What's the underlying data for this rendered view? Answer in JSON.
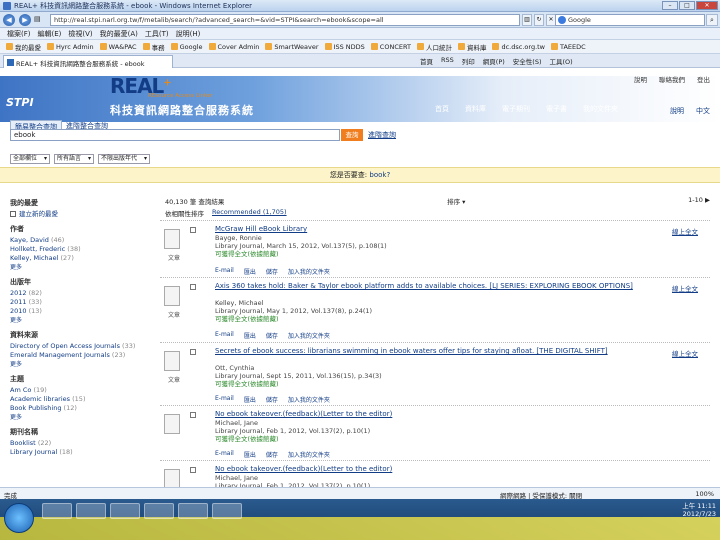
{
  "window": {
    "title": "REAL+ 科技資訊網路整合服務系統 - ebook - Windows Internet Explorer",
    "address": "http://real.stpi.narl.org.tw/f/metalib/search/?advanced_search=&vid=STPI&search=ebook&scope=all",
    "search_engine": "Google",
    "menu": [
      "檔案(F)",
      "編輯(E)",
      "檢視(V)",
      "我的最愛(A)",
      "工具(T)",
      "說明(H)"
    ],
    "favorites": [
      "我的最愛",
      "Hyrc Admin",
      "WA&PAC",
      "事務",
      "Google",
      "Cover Admin",
      "SmartWeaver",
      "ISS NDDS",
      "CONCERT",
      "人口統計",
      "資料庫",
      "dc.dsc.org.tw",
      "TAEEDC"
    ],
    "tab": "REAL+ 科技資訊網路整合服務系統 - ebook",
    "commands": [
      "首頁",
      "RSS",
      "列印",
      "網頁(P)",
      "安全性(S)",
      "工具(O)"
    ]
  },
  "header": {
    "logo_org": "STPI",
    "logo_name": "REAL",
    "logo_plus": "+",
    "logo_sub": "REsource Access Linker",
    "logo_cn": "科技資訊網路整合服務系統",
    "top_links": [
      "說明",
      "聯絡我們",
      "登出"
    ],
    "nav": [
      "首頁",
      "資料庫",
      "電子期刊",
      "電子書",
      "我的文件夾"
    ],
    "nav_right": [
      "說明",
      "中文"
    ]
  },
  "search": {
    "tabs": [
      "簡易整合查詢",
      "進階整合查詢"
    ],
    "query": "ebook",
    "button": "查詢",
    "advanced": "進階查詢",
    "filters": [
      "全部欄位",
      "所有語言",
      "不限出版年代"
    ]
  },
  "suggestion": {
    "prefix": "您是否要查: ",
    "term": "book?"
  },
  "facets": [
    {
      "heading": "我的最愛",
      "items": [
        {
          "label": "建立新的最愛",
          "count": ""
        }
      ],
      "more": ""
    },
    {
      "heading": "作者",
      "items": [
        {
          "label": "Kaye, David",
          "count": "(46)"
        },
        {
          "label": "Hollkett, Frederic",
          "count": "(38)"
        },
        {
          "label": "Kelley, Michael",
          "count": "(27)"
        }
      ],
      "more": "更多"
    },
    {
      "heading": "出版年",
      "items": [
        {
          "label": "2012",
          "count": "(82)"
        },
        {
          "label": "2011",
          "count": "(33)"
        },
        {
          "label": "2010",
          "count": "(13)"
        }
      ],
      "more": "更多"
    },
    {
      "heading": "資料來源",
      "items": [
        {
          "label": "Directory of Open Access Journals",
          "count": "(33)"
        },
        {
          "label": "Emerald Management Journals",
          "count": "(23)"
        }
      ],
      "more": "更多"
    },
    {
      "heading": "主題",
      "items": [
        {
          "label": "Am Co",
          "count": "(19)"
        },
        {
          "label": "Academic libraries",
          "count": "(15)"
        },
        {
          "label": "Book Publishing",
          "count": "(12)"
        }
      ],
      "more": "更多"
    },
    {
      "heading": "期刊名稱",
      "items": [
        {
          "label": "Booklist",
          "count": "(22)"
        },
        {
          "label": "Library Journal",
          "count": "(18)"
        }
      ],
      "more": ""
    }
  ],
  "results_header": {
    "summary": "40,130 筆 查詢結果",
    "sort_label": "依相關性排序",
    "pager": "1-10",
    "sort_by": "排序",
    "relevance_link": "Recommended (1,705)"
  },
  "results": [
    {
      "title": "McGraw Hill eBook Library",
      "meta1": "Bayge, Ronnie",
      "meta2": "Library Journal, March 15, 2012, Vol.137(5), p.108(1)",
      "avail": "可獲得全文(依據館藏)",
      "type": "文章",
      "actions": [
        "E-mail",
        "匯出",
        "儲存",
        "加入我的文件夾"
      ],
      "full": "線上全文"
    },
    {
      "title": "Axis 360 takes hold: Baker & Taylor ebook platform adds to available choices. [LJ SERIES: EXPLORING EBOOK OPTIONS]",
      "meta1": "Kelley, Michael",
      "meta2": "Library Journal, May 1, 2012, Vol.137(8), p.24(1)",
      "avail": "可獲得全文(依據館藏)",
      "type": "文章",
      "actions": [
        "E-mail",
        "匯出",
        "儲存",
        "加入我的文件夾"
      ],
      "full": "線上全文"
    },
    {
      "title": "Secrets of ebook success: librarians swimming in ebook waters offer tips for staying afloat. [THE DIGITAL SHIFT]",
      "meta1": "Ott, Cynthia",
      "meta2": "Library Journal, Sept 15, 2011, Vol.136(15), p.34(3)",
      "avail": "可獲得全文(依據館藏)",
      "type": "文章",
      "actions": [
        "E-mail",
        "匯出",
        "儲存",
        "加入我的文件夾"
      ],
      "full": "線上全文"
    },
    {
      "title": "No ebook takeover.(feedback)(Letter to the editor)",
      "meta1": "Michael, Jane",
      "meta2": "Library Journal, Feb 1, 2012, Vol.137(2), p.10(1)",
      "avail": "可獲得全文(依據館藏)",
      "type": "",
      "actions": [
        "E-mail",
        "匯出",
        "儲存",
        "加入我的文件夾"
      ],
      "full": ""
    },
    {
      "title": "No ebook takeover.(feedback)(Letter to the editor)",
      "meta1": "Michael, Jane",
      "meta2": "Library Journal, Feb 1, 2012, Vol.137(2), p.10(1)",
      "avail": "",
      "type": "",
      "actions": [],
      "full": ""
    }
  ],
  "statusbar": {
    "left": "完成",
    "zone": "網際網路 | 受保護模式: 關閉",
    "zoom": "100%"
  },
  "taskbar": {
    "time": "上午 11:11",
    "date": "2012/7/23"
  },
  "colors": {
    "link": "#123d86",
    "accent_orange": "#f07e1e",
    "avail_green": "#2c8a2c",
    "suggest_bg": "#fdf5c9"
  }
}
